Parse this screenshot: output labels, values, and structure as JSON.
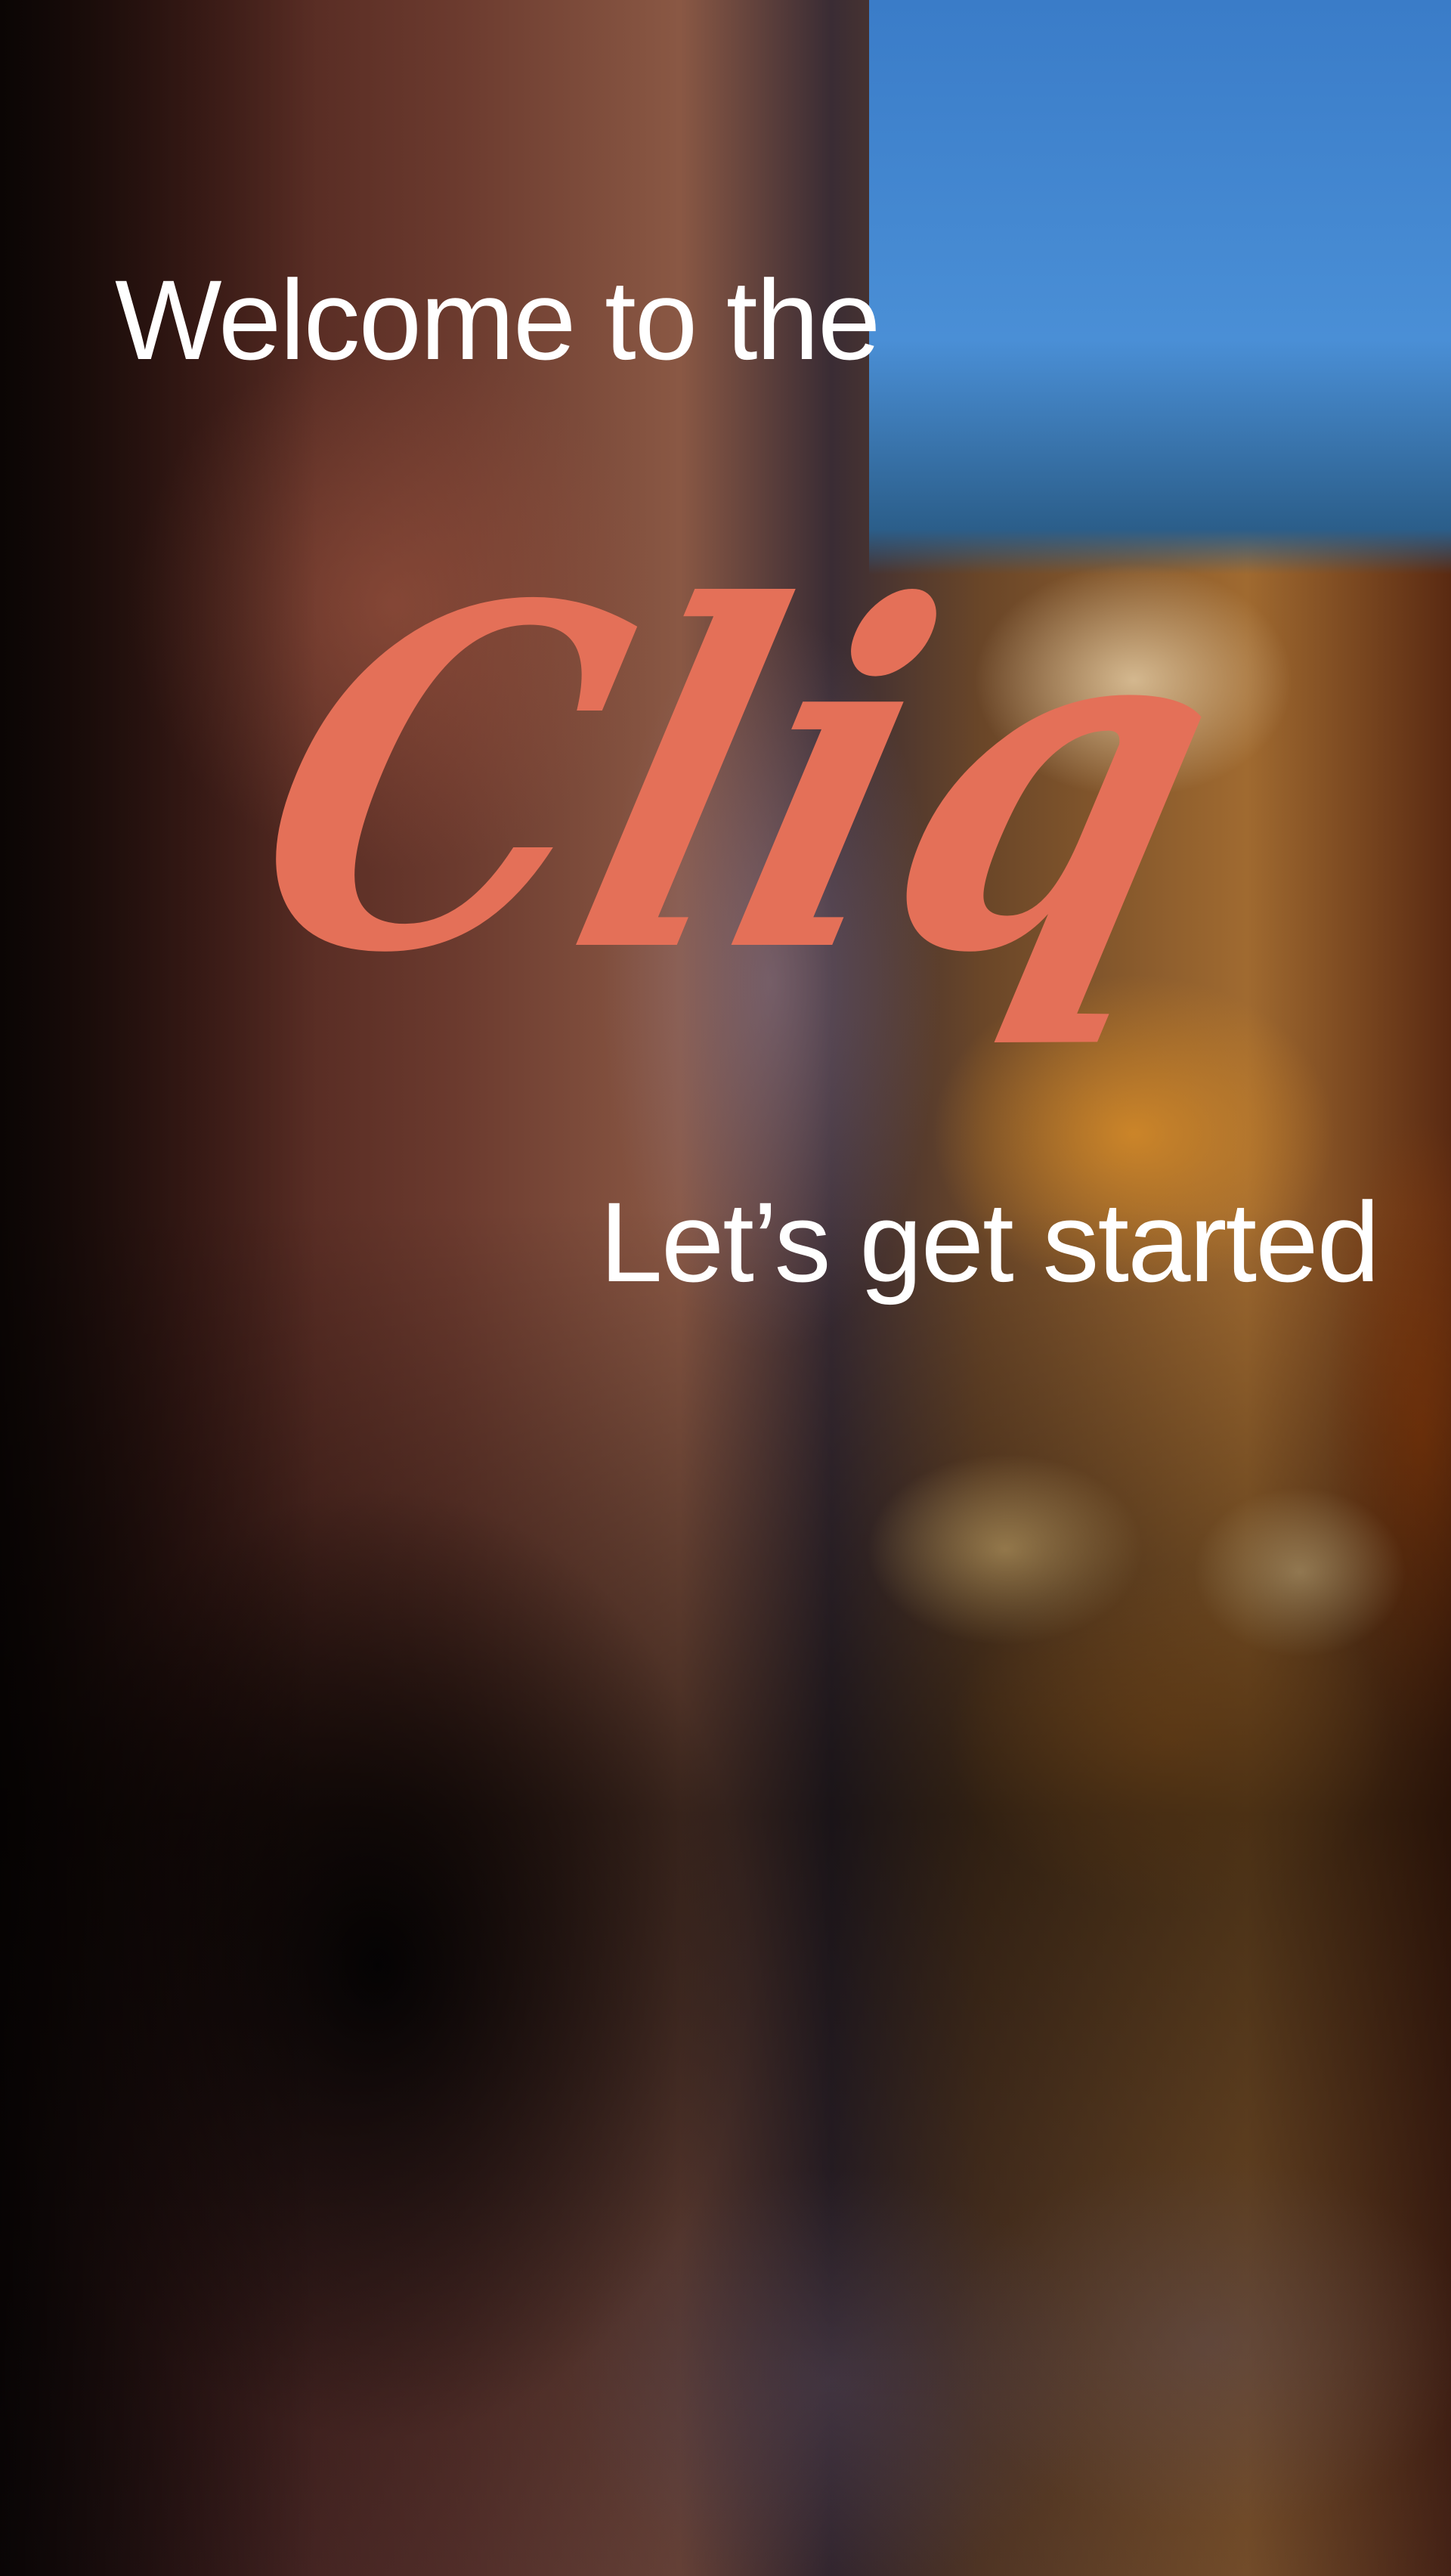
{
  "welcome": {
    "line": "Welcome to the"
  },
  "logo": {
    "text": "Cliq",
    "color": "#e47058"
  },
  "cta": {
    "label": "Let’s get started",
    "color": "#ffffff"
  }
}
